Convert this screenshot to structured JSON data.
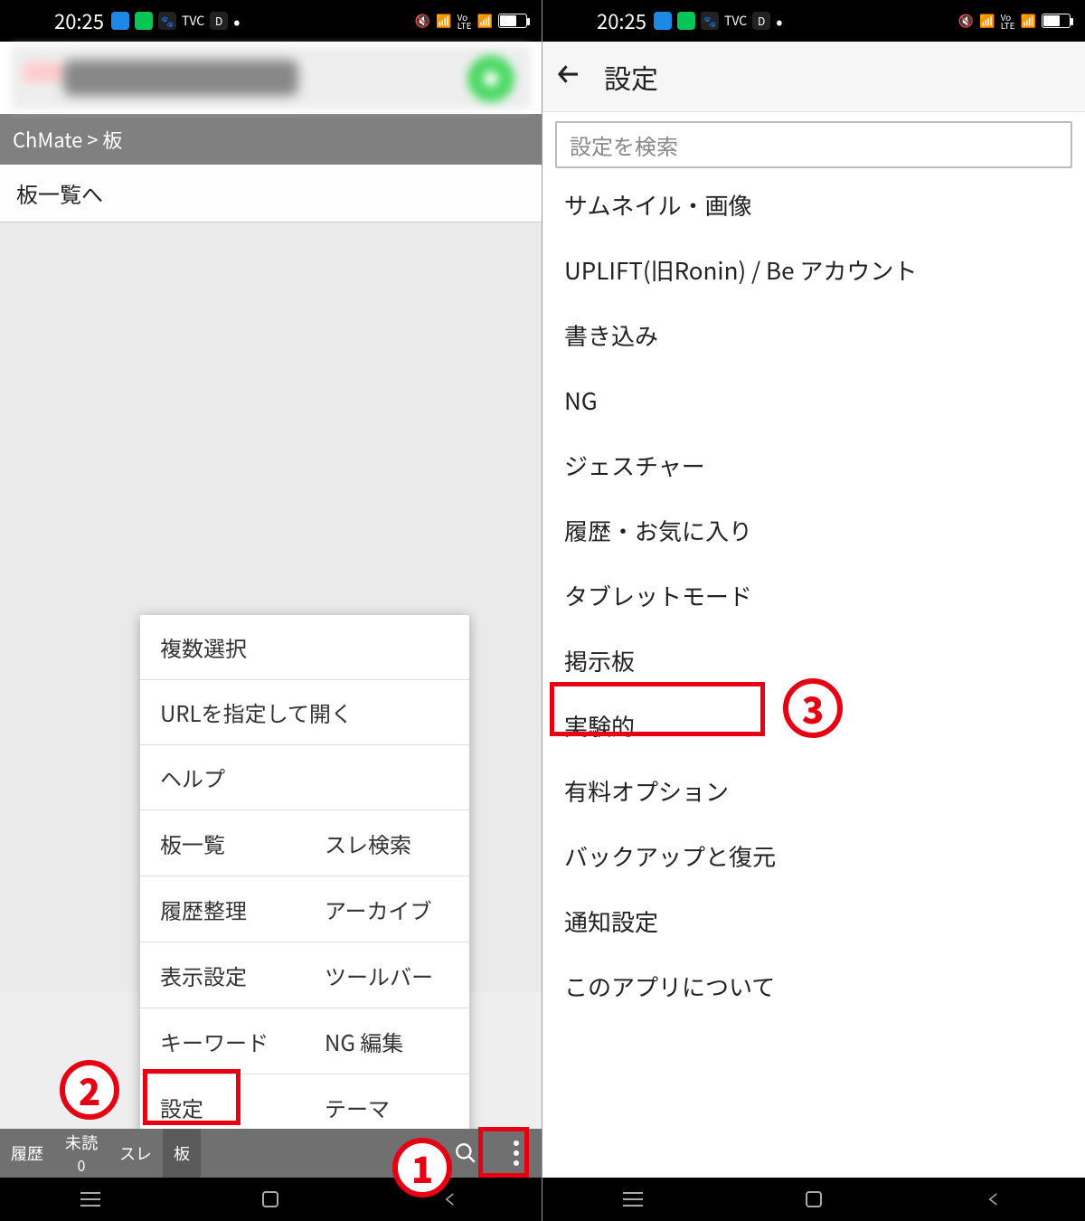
{
  "status": {
    "time": "20:25",
    "volte": "Vo\nLTE"
  },
  "left": {
    "breadcrumb": "ChMate > 板",
    "row_board_list": "板一覧へ",
    "popup": {
      "multi_select": "複数選択",
      "open_url": "URLを指定して開く",
      "help": "ヘルプ",
      "grid": {
        "board_list": "板一覧",
        "thread_search": "スレ検索",
        "history_cleanup": "履歴整理",
        "archive": "アーカイブ",
        "display_settings": "表示設定",
        "toolbar": "ツールバー",
        "keyword": "キーワード",
        "ng_edit": "NG 編集",
        "settings": "設定",
        "theme": "テーマ"
      }
    },
    "tabs": {
      "history": "履歴",
      "unread_label": "未読",
      "unread_count": "0",
      "thread": "スレ",
      "board": "板"
    }
  },
  "right": {
    "title": "設定",
    "search_placeholder": "設定を検索",
    "items": {
      "thumbnail": "サムネイル・画像",
      "uplift": "UPLIFT(旧Ronin) / Be アカウント",
      "write": "書き込み",
      "ng": "NG",
      "gesture": "ジェスチャー",
      "history_fav": "履歴・お気に入り",
      "tablet": "タブレットモード",
      "board": "掲示板",
      "experimental": "実験的",
      "paid": "有料オプション",
      "backup": "バックアップと復元",
      "notification": "通知設定",
      "about": "このアプリについて"
    }
  },
  "callouts": {
    "one": "1",
    "two": "2",
    "three": "3"
  }
}
